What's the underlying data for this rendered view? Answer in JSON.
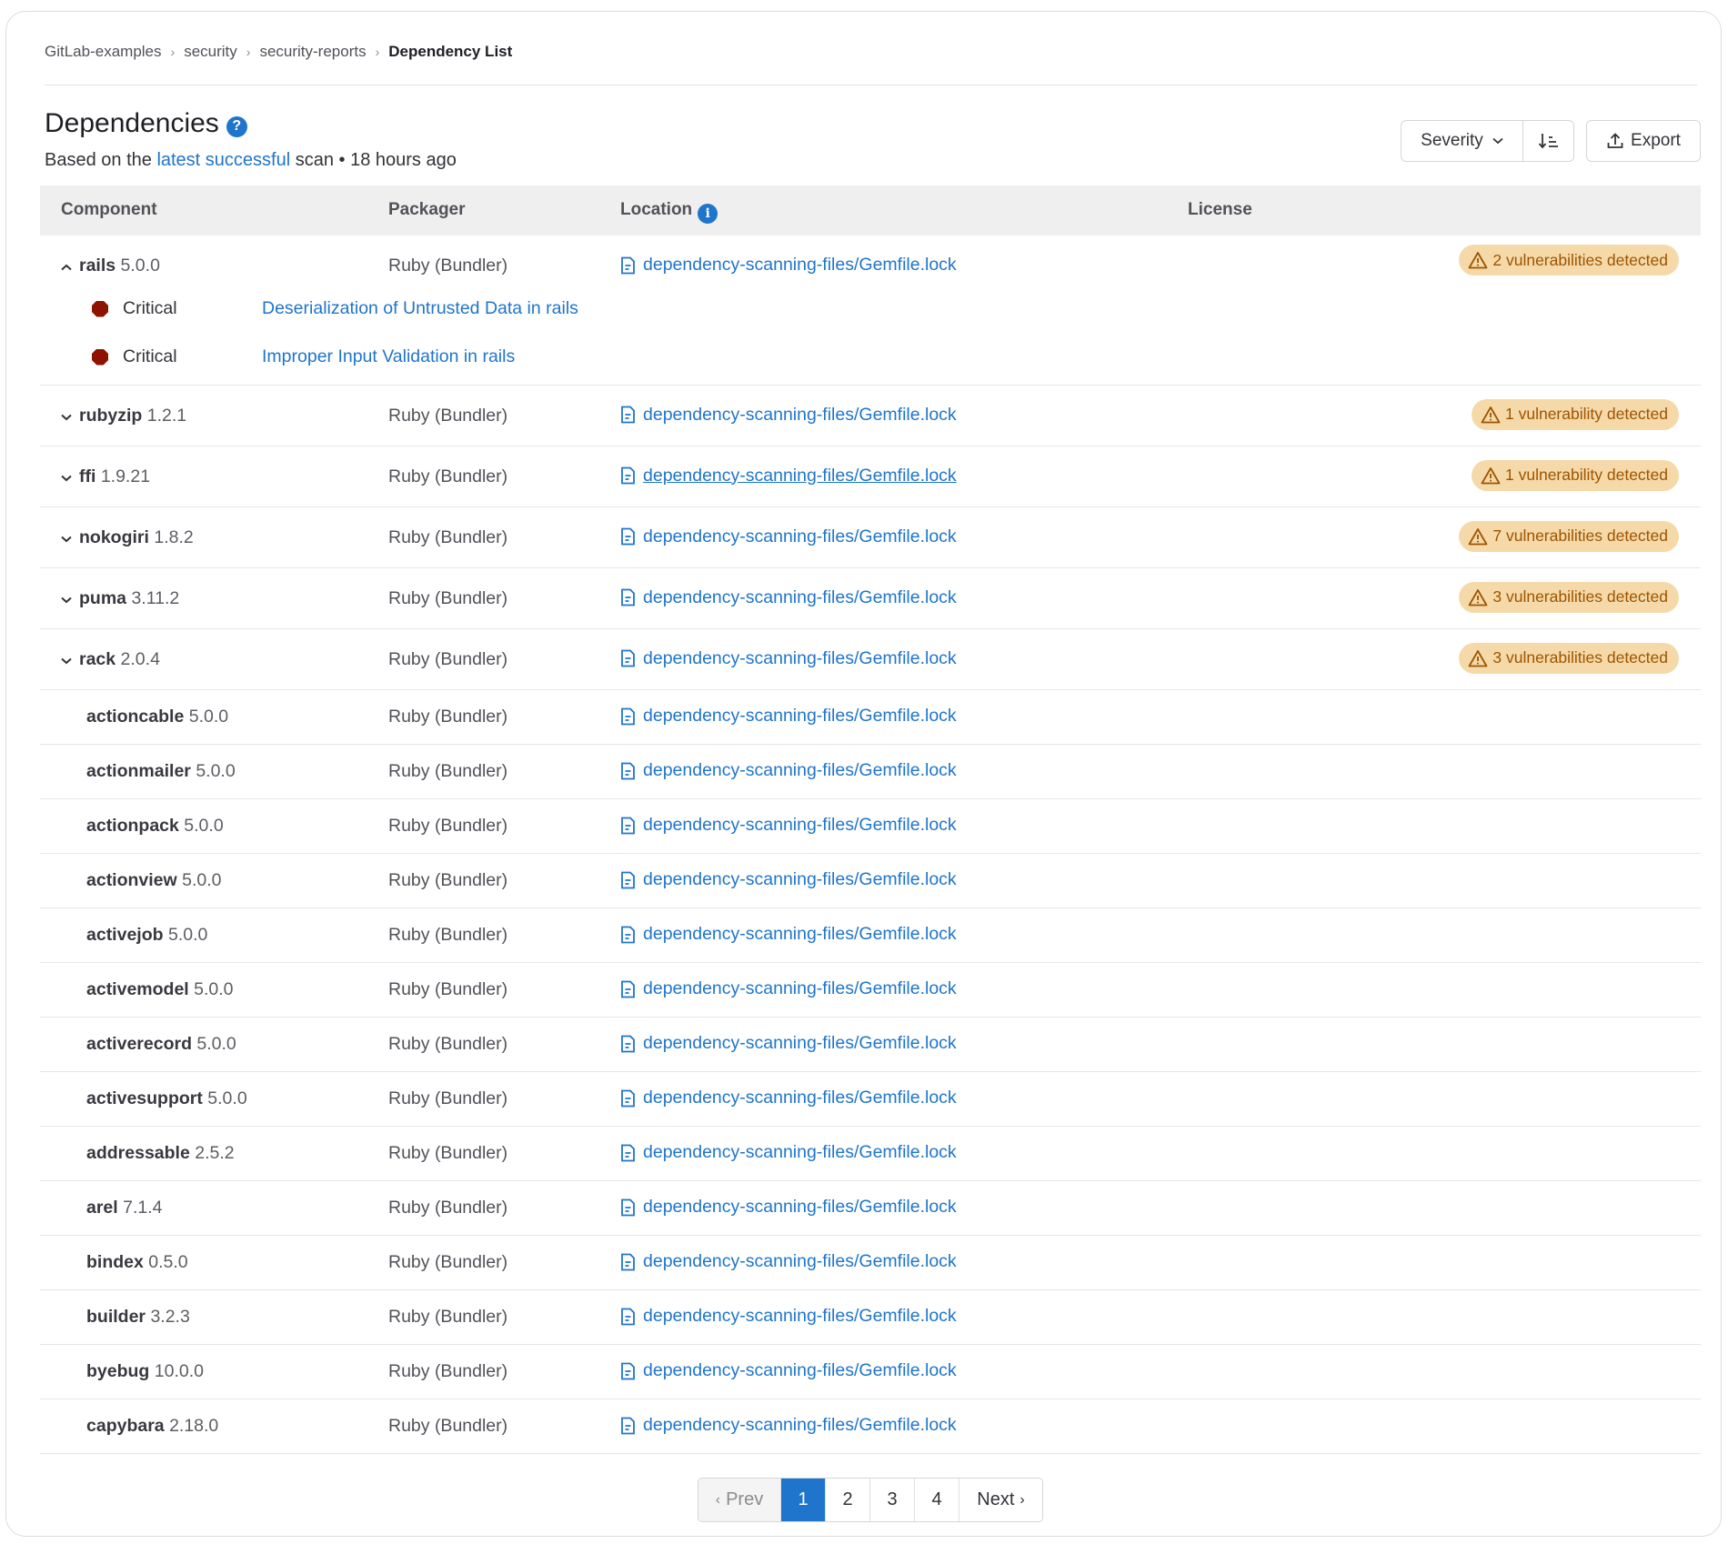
{
  "breadcrumb": [
    "GitLab-examples",
    "security",
    "security-reports",
    "Dependency List"
  ],
  "header": {
    "title": "Dependencies",
    "subtitle_prefix": "Based on the",
    "subtitle_link": "latest successful",
    "subtitle_suffix": "scan • 18 hours ago"
  },
  "toolbar": {
    "sort_label": "Severity",
    "export_label": "Export"
  },
  "columns": [
    "Component",
    "Packager",
    "Location",
    "License"
  ],
  "colors": {
    "link": "#1f75cb",
    "badge_bg": "#f5d9a8",
    "badge_text": "#9e5400",
    "critical": "#8d1300",
    "active_page": "#1f75cb"
  },
  "rows": [
    {
      "name": "rails",
      "version": "5.0.0",
      "packager": "Ruby (Bundler)",
      "location": "dependency-scanning-files/Gemfile.lock",
      "badge": "2 vulnerabilities detected",
      "expanded": true,
      "vulnerabilities": [
        {
          "severity": "Critical",
          "title": "Deserialization of Untrusted Data in rails"
        },
        {
          "severity": "Critical",
          "title": "Improper Input Validation in rails"
        }
      ]
    },
    {
      "name": "rubyzip",
      "version": "1.2.1",
      "packager": "Ruby (Bundler)",
      "location": "dependency-scanning-files/Gemfile.lock",
      "badge": "1 vulnerability detected"
    },
    {
      "name": "ffi",
      "version": "1.9.21",
      "packager": "Ruby (Bundler)",
      "location": "dependency-scanning-files/Gemfile.lock",
      "badge": "1 vulnerability detected"
    },
    {
      "name": "nokogiri",
      "version": "1.8.2",
      "packager": "Ruby (Bundler)",
      "location": "dependency-scanning-files/Gemfile.lock",
      "badge": "7 vulnerabilities detected"
    },
    {
      "name": "puma",
      "version": "3.11.2",
      "packager": "Ruby (Bundler)",
      "location": "dependency-scanning-files/Gemfile.lock",
      "badge": "3 vulnerabilities detected"
    },
    {
      "name": "rack",
      "version": "2.0.4",
      "packager": "Ruby (Bundler)",
      "location": "dependency-scanning-files/Gemfile.lock",
      "badge": "3 vulnerabilities detected"
    },
    {
      "name": "actioncable",
      "version": "5.0.0",
      "packager": "Ruby (Bundler)",
      "location": "dependency-scanning-files/Gemfile.lock"
    },
    {
      "name": "actionmailer",
      "version": "5.0.0",
      "packager": "Ruby (Bundler)",
      "location": "dependency-scanning-files/Gemfile.lock"
    },
    {
      "name": "actionpack",
      "version": "5.0.0",
      "packager": "Ruby (Bundler)",
      "location": "dependency-scanning-files/Gemfile.lock"
    },
    {
      "name": "actionview",
      "version": "5.0.0",
      "packager": "Ruby (Bundler)",
      "location": "dependency-scanning-files/Gemfile.lock"
    },
    {
      "name": "activejob",
      "version": "5.0.0",
      "packager": "Ruby (Bundler)",
      "location": "dependency-scanning-files/Gemfile.lock"
    },
    {
      "name": "activemodel",
      "version": "5.0.0",
      "packager": "Ruby (Bundler)",
      "location": "dependency-scanning-files/Gemfile.lock"
    },
    {
      "name": "activerecord",
      "version": "5.0.0",
      "packager": "Ruby (Bundler)",
      "location": "dependency-scanning-files/Gemfile.lock"
    },
    {
      "name": "activesupport",
      "version": "5.0.0",
      "packager": "Ruby (Bundler)",
      "location": "dependency-scanning-files/Gemfile.lock"
    },
    {
      "name": "addressable",
      "version": "2.5.2",
      "packager": "Ruby (Bundler)",
      "location": "dependency-scanning-files/Gemfile.lock"
    },
    {
      "name": "arel",
      "version": "7.1.4",
      "packager": "Ruby (Bundler)",
      "location": "dependency-scanning-files/Gemfile.lock"
    },
    {
      "name": "bindex",
      "version": "0.5.0",
      "packager": "Ruby (Bundler)",
      "location": "dependency-scanning-files/Gemfile.lock"
    },
    {
      "name": "builder",
      "version": "3.2.3",
      "packager": "Ruby (Bundler)",
      "location": "dependency-scanning-files/Gemfile.lock"
    },
    {
      "name": "byebug",
      "version": "10.0.0",
      "packager": "Ruby (Bundler)",
      "location": "dependency-scanning-files/Gemfile.lock"
    },
    {
      "name": "capybara",
      "version": "2.18.0",
      "packager": "Ruby (Bundler)",
      "location": "dependency-scanning-files/Gemfile.lock"
    }
  ],
  "pagination": {
    "prev_label": "Prev",
    "next_label": "Next",
    "pages": [
      "1",
      "2",
      "3",
      "4"
    ],
    "current": "1"
  }
}
